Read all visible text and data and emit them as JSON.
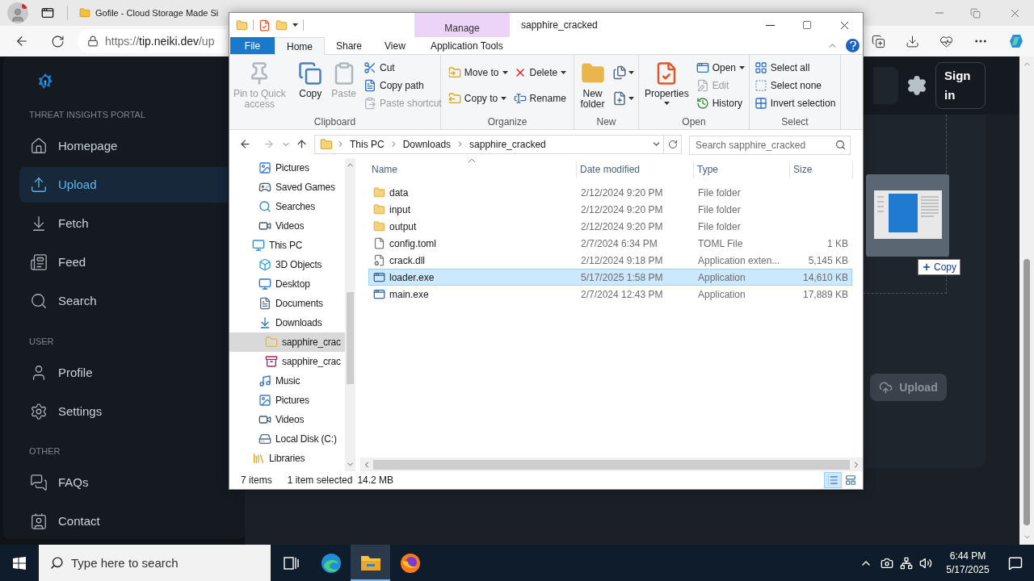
{
  "browser": {
    "tabs": [
      {
        "title": "Gofile - Cloud Storage Made Si",
        "selected": false
      }
    ],
    "address": {
      "scheme": "https://",
      "host": "tip.neiki.dev",
      "path": "/up"
    }
  },
  "web": {
    "sidebar": {
      "sections": [
        {
          "heading": "THREAT INSIGHTS PORTAL",
          "items": [
            {
              "label": "Homepage",
              "selected": false
            },
            {
              "label": "Upload",
              "selected": true
            },
            {
              "label": "Fetch",
              "selected": false
            },
            {
              "label": "Feed",
              "selected": false
            },
            {
              "label": "Search",
              "selected": false
            }
          ]
        },
        {
          "heading": "USER",
          "items": [
            {
              "label": "Profile",
              "selected": false
            },
            {
              "label": "Settings",
              "selected": false
            }
          ]
        },
        {
          "heading": "OTHER",
          "items": [
            {
              "label": "FAQs",
              "selected": false
            },
            {
              "label": "Contact",
              "selected": false
            }
          ]
        }
      ]
    },
    "sign_in": "Sign in",
    "drag_tooltip": "Copy",
    "upload_button": {
      "label": "Upload",
      "disabled": true
    }
  },
  "explorer": {
    "title": "sapphire_cracked",
    "tabs": [
      {
        "label": "File",
        "kind": "backstage",
        "selected": false
      },
      {
        "label": "Home",
        "kind": "tab",
        "selected": true
      },
      {
        "label": "Share",
        "kind": "tab",
        "selected": false
      },
      {
        "label": "View",
        "kind": "tab",
        "selected": false
      },
      {
        "label": "Application Tools",
        "kind": "context",
        "header": "Manage",
        "selected": false
      }
    ],
    "ribbon": [
      {
        "label": "Clipboard",
        "columns": [
          [
            {
              "label": "Pin to Quick access",
              "kind": "large",
              "disabled": true,
              "dropdown": false
            }
          ],
          [
            {
              "label": "Copy",
              "kind": "large",
              "disabled": false,
              "dropdown": false
            }
          ],
          [
            {
              "label": "Paste",
              "kind": "large",
              "disabled": true,
              "dropdown": false
            }
          ],
          [
            {
              "label": "Cut",
              "kind": "small",
              "disabled": false,
              "dropdown": false
            },
            {
              "label": "Copy path",
              "kind": "small",
              "disabled": false,
              "dropdown": false
            },
            {
              "label": "Paste shortcut",
              "kind": "small",
              "disabled": true,
              "dropdown": false
            }
          ]
        ]
      },
      {
        "label": "Organize",
        "columns": [
          [
            {
              "label": "Move to",
              "kind": "medium",
              "disabled": false,
              "dropdown": true
            },
            {
              "label": "Copy to",
              "kind": "medium",
              "disabled": false,
              "dropdown": true
            }
          ],
          [
            {
              "label": "Delete",
              "kind": "medium",
              "disabled": false,
              "dropdown": true
            },
            {
              "label": "Rename",
              "kind": "medium",
              "disabled": false,
              "dropdown": false
            }
          ]
        ]
      },
      {
        "label": "New",
        "columns": [
          [
            {
              "label": "New folder",
              "kind": "large",
              "disabled": false,
              "dropdown": false
            }
          ],
          [
            {
              "kind": "icon",
              "disabled": false,
              "dropdown": true
            },
            {
              "kind": "icon",
              "disabled": false,
              "dropdown": true
            }
          ]
        ]
      },
      {
        "label": "Open",
        "columns": [
          [
            {
              "label": "Properties",
              "kind": "large",
              "disabled": false,
              "dropdown": true
            }
          ],
          [
            {
              "label": "Open",
              "kind": "small",
              "disabled": false,
              "dropdown": true
            },
            {
              "label": "Edit",
              "kind": "small",
              "disabled": true,
              "dropdown": false
            },
            {
              "label": "History",
              "kind": "small",
              "disabled": false,
              "dropdown": false
            }
          ]
        ]
      },
      {
        "label": "Select",
        "columns": [
          [
            {
              "label": "Select all",
              "kind": "small",
              "disabled": false,
              "dropdown": false
            },
            {
              "label": "Select none",
              "kind": "small",
              "disabled": false,
              "dropdown": false
            },
            {
              "label": "Invert selection",
              "kind": "small",
              "disabled": false,
              "dropdown": false
            }
          ]
        ]
      }
    ],
    "crumbs": [
      "This PC",
      "Downloads",
      "sapphire_cracked"
    ],
    "search": {
      "placeholder": "Search sapphire_cracked"
    },
    "nav": [
      {
        "children": [
          {
            "label": "Pictures",
            "kind": "pictures",
            "selected": false
          },
          {
            "label": "Saved Games",
            "kind": "games",
            "selected": false
          },
          {
            "label": "Searches",
            "kind": "searches",
            "selected": false
          },
          {
            "label": "Videos",
            "kind": "videos",
            "selected": false
          }
        ]
      },
      {
        "label": "This PC",
        "kind": "pc",
        "selected": false,
        "children": [
          {
            "label": "3D Objects",
            "kind": "objects",
            "selected": false
          },
          {
            "label": "Desktop",
            "kind": "desktop",
            "selected": false
          },
          {
            "label": "Documents",
            "kind": "documents",
            "selected": false
          },
          {
            "label": "Downloads",
            "kind": "downloads",
            "selected": false,
            "children": [
              {
                "label": "sapphire_crac",
                "kind": "folder",
                "selected": true
              },
              {
                "label": "sapphire_crac",
                "kind": "archive",
                "selected": false
              }
            ]
          },
          {
            "label": "Music",
            "kind": "music",
            "selected": false
          },
          {
            "label": "Pictures",
            "kind": "pictures",
            "selected": false
          },
          {
            "label": "Videos",
            "kind": "videos",
            "selected": false
          },
          {
            "label": "Local Disk (C:)",
            "kind": "disk",
            "selected": false
          }
        ]
      },
      {
        "label": "Libraries",
        "kind": "libraries",
        "selected": false
      }
    ],
    "columns": [
      "Name",
      "Date modified",
      "Type",
      "Size"
    ],
    "files": [
      {
        "name": "data",
        "date": "2/12/2024 9:20 PM",
        "type": "File folder",
        "kind": "folder",
        "selected": false
      },
      {
        "name": "input",
        "date": "2/12/2024 9:20 PM",
        "type": "File folder",
        "kind": "folder",
        "selected": false
      },
      {
        "name": "output",
        "date": "2/12/2024 9:20 PM",
        "type": "File folder",
        "kind": "folder",
        "selected": false
      },
      {
        "name": "config.toml",
        "date": "2/7/2024 6:34 PM",
        "type": "TOML File",
        "size": "1 KB",
        "kind": "file",
        "selected": false
      },
      {
        "name": "crack.dll",
        "date": "2/12/2024 9:18 PM",
        "type": "Application exten...",
        "size": "5,145 KB",
        "kind": "library",
        "selected": false
      },
      {
        "name": "loader.exe",
        "date": "5/17/2025 1:58 PM",
        "type": "Application",
        "size": "14,610 KB",
        "kind": "application",
        "selected": true
      },
      {
        "name": "main.exe",
        "date": "2/7/2024 12:43 PM",
        "type": "Application",
        "size": "17,889 KB",
        "kind": "application",
        "selected": false
      }
    ],
    "status": {
      "count": "7 items",
      "selection": "1 item selected",
      "size": "14.2 MB"
    },
    "views": [
      {
        "kind": "details",
        "selected": true
      },
      {
        "kind": "thumbnails",
        "selected": false
      }
    ]
  },
  "taskbar": {
    "search_placeholder": "Type here to search",
    "apps": [
      {
        "kind": "taskview",
        "selected": false
      },
      {
        "kind": "edge",
        "selected": false
      },
      {
        "kind": "explorer",
        "selected": true
      },
      {
        "kind": "firefox",
        "selected": false
      }
    ],
    "time": "6:44 PM",
    "date": "5/17/2025"
  }
}
